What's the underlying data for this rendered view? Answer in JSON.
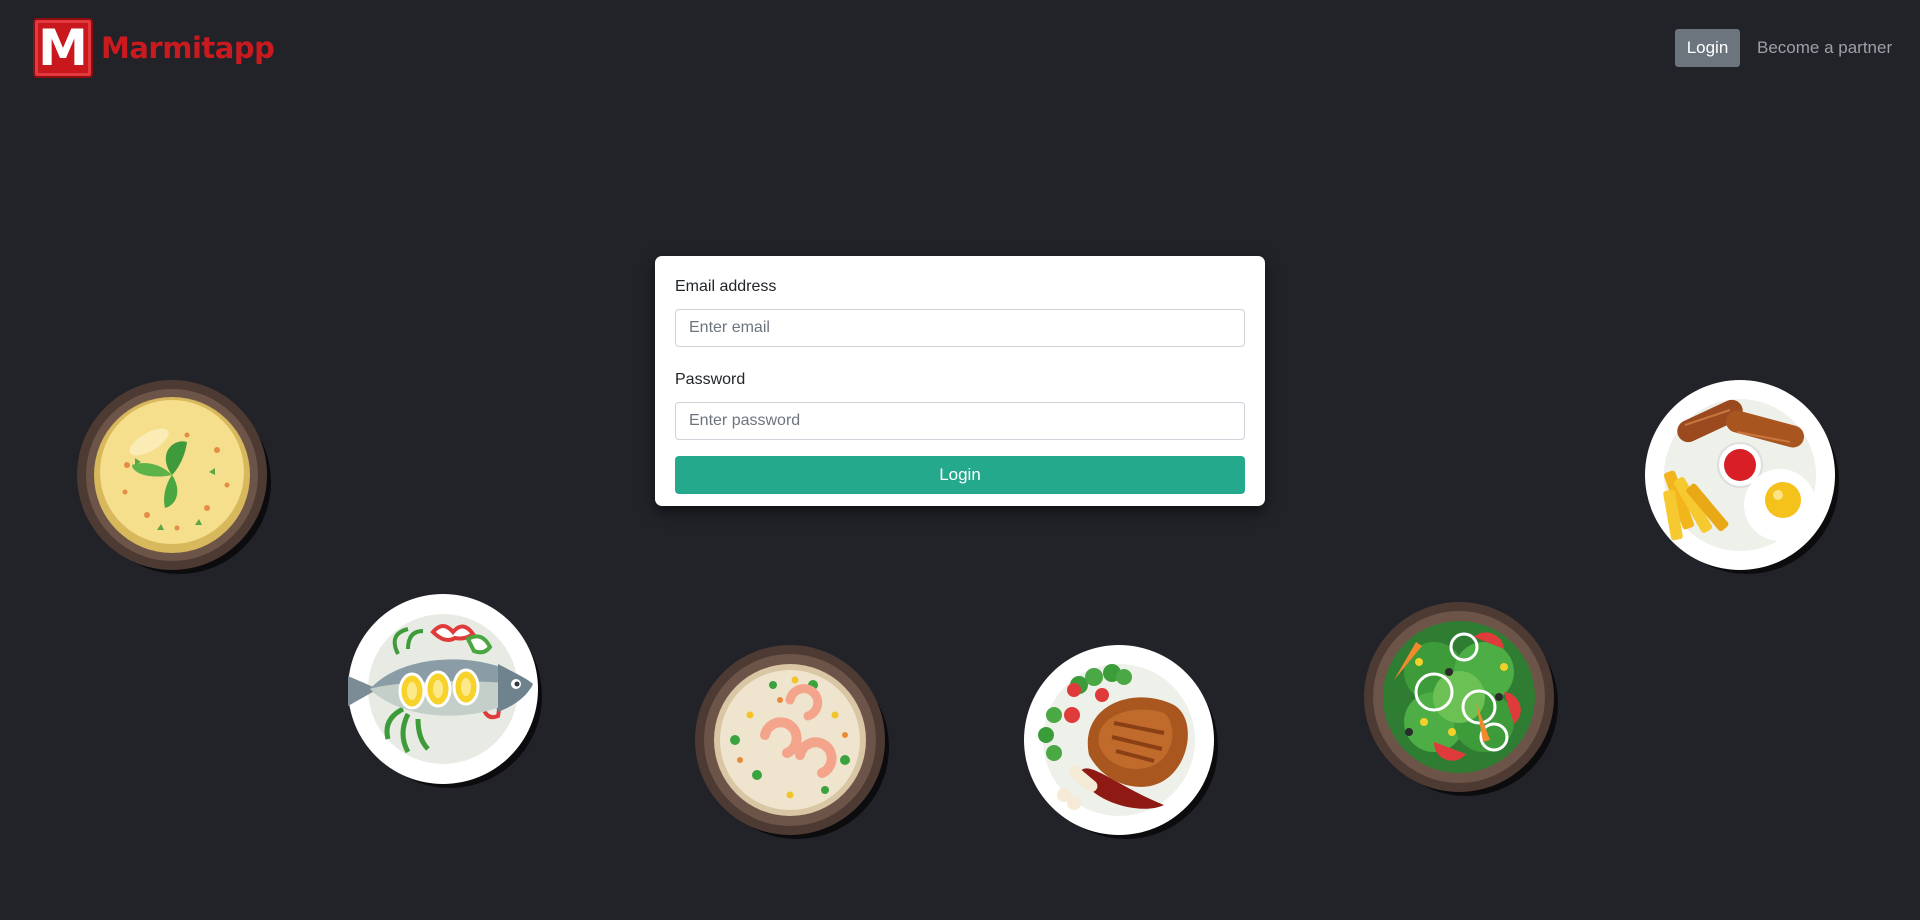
{
  "navbar": {
    "brand_letter": "M",
    "brand_name": "Marmitapp",
    "login_label": "Login",
    "partner_label": "Become a partner"
  },
  "login_form": {
    "email_label": "Email address",
    "email_placeholder": "Enter email",
    "email_value": "",
    "password_label": "Password",
    "password_placeholder": "Enter password",
    "password_value": "",
    "submit_label": "Login"
  },
  "dishes": [
    {
      "name": "omelette-bowl",
      "icon": "omelette-icon"
    },
    {
      "name": "fish-plate",
      "icon": "fish-icon"
    },
    {
      "name": "shrimp-rice-bowl",
      "icon": "rice-icon"
    },
    {
      "name": "chicken-leg-plate",
      "icon": "chicken-icon"
    },
    {
      "name": "salad-bowl",
      "icon": "salad-icon"
    },
    {
      "name": "sausage-breakfast-plate",
      "icon": "breakfast-icon"
    }
  ],
  "colors": {
    "background": "#212329",
    "brand_red": "#c91a1f",
    "primary_button": "#24a98c",
    "secondary_button": "#6c757d"
  }
}
